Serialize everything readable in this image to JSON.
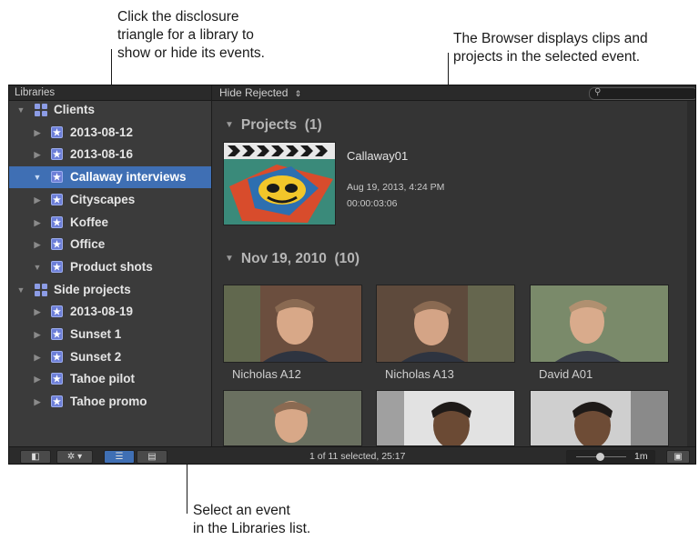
{
  "callouts": {
    "disclosure": [
      "Click the disclosure",
      "triangle for a library to",
      "show or hide its events."
    ],
    "browser": [
      "The Browser displays clips and",
      "projects in the selected event."
    ],
    "select_event": [
      "Select an event",
      "in the Libraries list."
    ]
  },
  "sidebar": {
    "header": "Libraries",
    "items": [
      {
        "label": "Clients",
        "type": "library",
        "expanded": true,
        "selected": false,
        "indent": 0
      },
      {
        "label": "2013-08-12",
        "type": "event",
        "expanded": false,
        "selected": false,
        "indent": 1
      },
      {
        "label": "2013-08-16",
        "type": "event",
        "expanded": false,
        "selected": false,
        "indent": 1
      },
      {
        "label": "Callaway interviews",
        "type": "event",
        "expanded": true,
        "selected": true,
        "indent": 1
      },
      {
        "label": "Cityscapes",
        "type": "event",
        "expanded": false,
        "selected": false,
        "indent": 1
      },
      {
        "label": "Koffee",
        "type": "event",
        "expanded": false,
        "selected": false,
        "indent": 1
      },
      {
        "label": "Office",
        "type": "event",
        "expanded": false,
        "selected": false,
        "indent": 1
      },
      {
        "label": "Product shots",
        "type": "event",
        "expanded": true,
        "selected": false,
        "indent": 1
      },
      {
        "label": "Side projects",
        "type": "library",
        "expanded": true,
        "selected": false,
        "indent": 0
      },
      {
        "label": "2013-08-19",
        "type": "event",
        "expanded": false,
        "selected": false,
        "indent": 1
      },
      {
        "label": "Sunset 1",
        "type": "event",
        "expanded": false,
        "selected": false,
        "indent": 1
      },
      {
        "label": "Sunset 2",
        "type": "event",
        "expanded": false,
        "selected": false,
        "indent": 1
      },
      {
        "label": "Tahoe pilot",
        "type": "event",
        "expanded": false,
        "selected": false,
        "indent": 1
      },
      {
        "label": "Tahoe promo",
        "type": "event",
        "expanded": false,
        "selected": false,
        "indent": 1
      }
    ]
  },
  "browser": {
    "filter_label": "Hide Rejected",
    "sections": {
      "projects": {
        "title": "Projects",
        "count": "(1)"
      },
      "clips": {
        "title": "Nov 19, 2010",
        "count": "(10)"
      }
    },
    "project": {
      "name": "Callaway01",
      "date": "Aug 19, 2013, 4:24 PM",
      "duration": "00:00:03:06"
    },
    "clips": [
      {
        "label": "Nicholas A12"
      },
      {
        "label": "Nicholas A13"
      },
      {
        "label": "David A01"
      },
      {
        "label": ""
      },
      {
        "label": ""
      },
      {
        "label": ""
      }
    ]
  },
  "bottombar": {
    "status": "1 of 11 selected, 25:17",
    "zoom": "1m"
  },
  "colors": {
    "selection": "#3f6fb4",
    "event_icon": "#6d7fd8",
    "panel_bg": "#343434",
    "sidebar_bg": "#3b3b3b"
  }
}
